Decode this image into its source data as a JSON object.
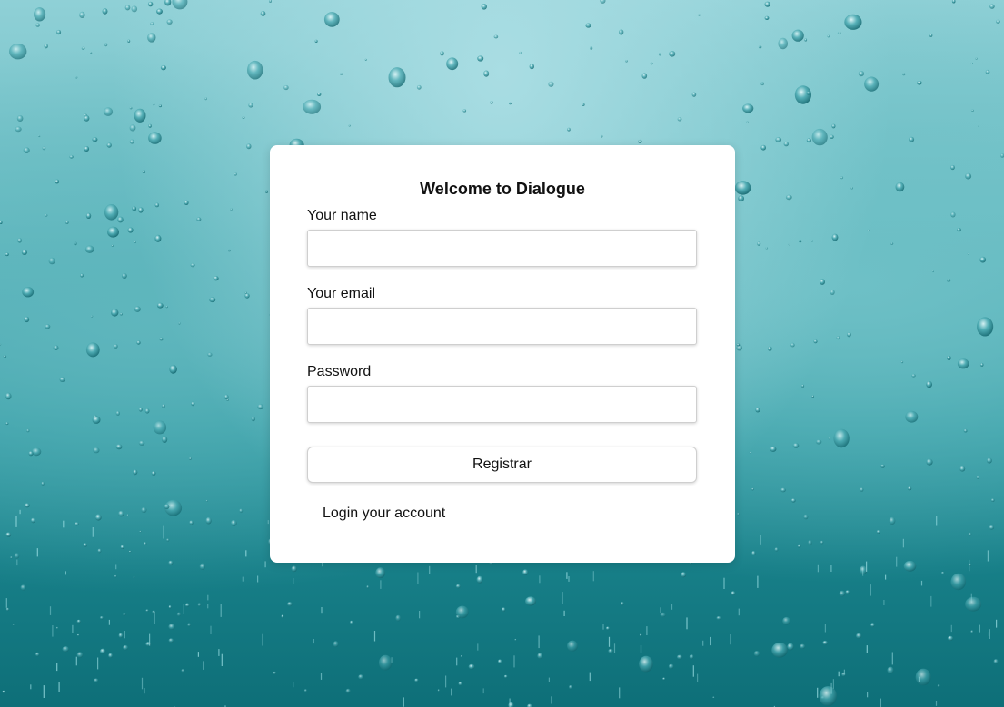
{
  "form": {
    "title": "Welcome to Dialogue",
    "name_label": "Your name",
    "name_value": "",
    "email_label": "Your email",
    "email_value": "",
    "password_label": "Password",
    "password_value": "",
    "submit_label": "Registrar",
    "login_link": "Login your account"
  },
  "theme": {
    "card_background": "#ffffff",
    "background_top": "#8fd0d6",
    "background_bottom": "#0e6f78"
  }
}
